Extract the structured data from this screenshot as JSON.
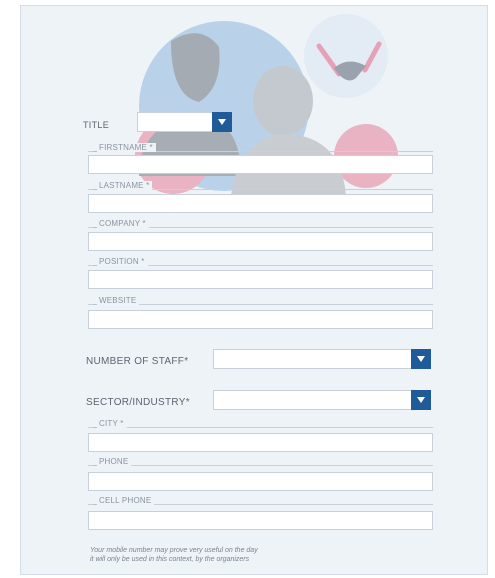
{
  "form": {
    "title_label": "TITLE",
    "fields": {
      "firstname": "FIRSTNAME *",
      "lastname": "LASTNAME *",
      "company": "COMPANY *",
      "position": "POSITION *",
      "website": "WEBSITE",
      "city": "CITY *",
      "phone": "PHONE",
      "cell_phone": "CELL PHONE"
    },
    "number_of_staff_label": "NUMBER OF STAFF*",
    "sector_label": "SECTOR/INDUSTRY*",
    "note_line1": "Your mobile number may prove very useful on the day",
    "note_line2": "it will only be used in this context, by the organizers"
  },
  "colors": {
    "accent": "#1f5a99",
    "background": "#eef3f8",
    "circle_blue": "#a9c8e6",
    "circle_pink": "#e8a8bb"
  },
  "icons": {
    "illustration": "people-handshake-illustration",
    "dropdown": "chevron-down-icon"
  }
}
